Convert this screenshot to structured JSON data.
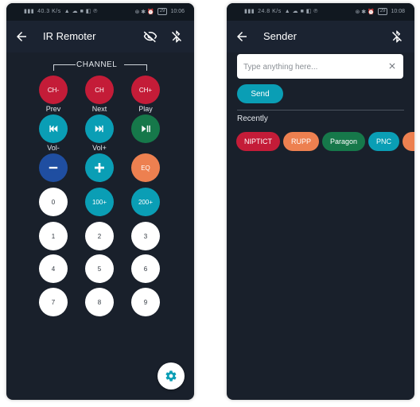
{
  "colors": {
    "background": "#19202b",
    "appbar": "#1b2331",
    "red": "#c41c38",
    "teal": "#0a9eb5",
    "green": "#16784a",
    "blue": "#1f4ea1",
    "orange": "#ed8050",
    "white": "#ffffff"
  },
  "remote": {
    "status": {
      "net": "40.3 K/s",
      "battery": "29",
      "time": "10:06"
    },
    "title": "IR Remoter",
    "channel_label": "CHANNEL",
    "channel_buttons": [
      "CH-",
      "CH",
      "CH+"
    ],
    "media_labels": [
      "Prev",
      "Next",
      "Play"
    ],
    "volume_labels": [
      "Vol-",
      "Vol+"
    ],
    "eq_label": "EQ",
    "number_buttons": [
      "0",
      "100+",
      "200+",
      "1",
      "2",
      "3",
      "4",
      "5",
      "6",
      "7",
      "8",
      "9"
    ],
    "icons": [
      "back-arrow-icon",
      "visibility-off-icon",
      "bluetooth-disabled-icon",
      "skip-previous-icon",
      "skip-next-icon",
      "play-pause-icon",
      "minus-icon",
      "plus-icon",
      "settings-gear-icon"
    ]
  },
  "sender": {
    "status": {
      "net": "24.8 K/s",
      "battery": "29",
      "time": "10:08"
    },
    "title": "Sender",
    "input_placeholder": "Type anything here...",
    "send_label": "Send",
    "recently_label": "Recently",
    "chips": [
      {
        "label": "NIPTICT",
        "color": "#c41c38"
      },
      {
        "label": "RUPP",
        "color": "#ed8050"
      },
      {
        "label": "Paragon",
        "color": "#16784a"
      },
      {
        "label": "PNC",
        "color": "#0a9eb5"
      },
      {
        "label": "",
        "color": "#ed8050"
      }
    ],
    "icons": [
      "back-arrow-icon",
      "bluetooth-disabled-icon",
      "clear-icon"
    ]
  }
}
